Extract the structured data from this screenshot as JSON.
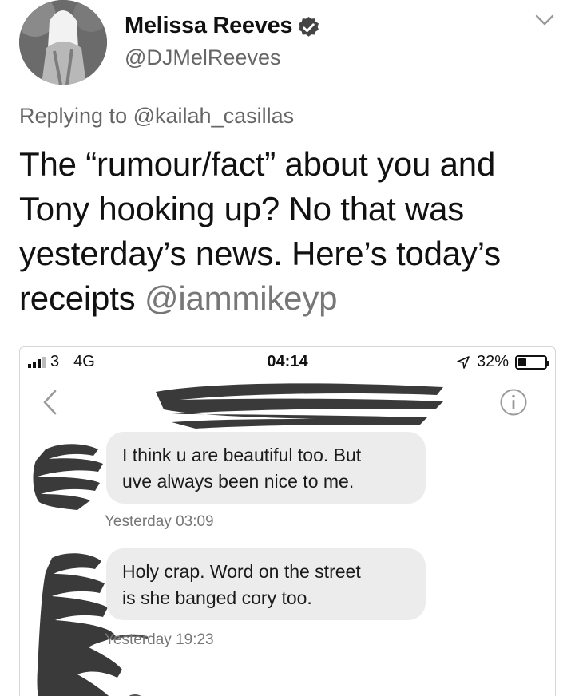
{
  "tweet": {
    "display_name": "Melissa Reeves",
    "handle": "@DJMelReeves",
    "verified": true,
    "replying_prefix": "Replying to",
    "replying_to": "@kailah_casillas",
    "text_lines": [
      "The “rumour/fact” about you and",
      "Tony hooking up? No that was",
      "yesterday’s news. Here’s today’s"
    ],
    "text_last_line": "receipts",
    "text_mention": "@iammikeyp"
  },
  "screenshot": {
    "status_bar": {
      "carrier": "3",
      "network": "4G",
      "time": "04:14",
      "battery_percent": 32,
      "battery_label": "32%"
    },
    "messages": [
      {
        "lines": [
          "I think u are beautiful too. But",
          "uve always been nice to me."
        ],
        "timestamp": "Yesterday 03:09"
      },
      {
        "lines": [
          "Holy crap. Word on the street",
          "is she banged cory too."
        ],
        "timestamp": "Yesterday 19:23"
      }
    ]
  },
  "icons": {
    "verified": "verified-badge-icon",
    "caret": "chevron-down-icon",
    "back": "chevron-left-icon",
    "info": "info-icon",
    "location": "location-arrow-icon",
    "battery": "battery-icon",
    "signal": "signal-bars-icon"
  },
  "colors": {
    "text": "#111111",
    "secondary_text": "#666666",
    "bubble": "#ececec",
    "redaction": "#3a3a3a"
  }
}
